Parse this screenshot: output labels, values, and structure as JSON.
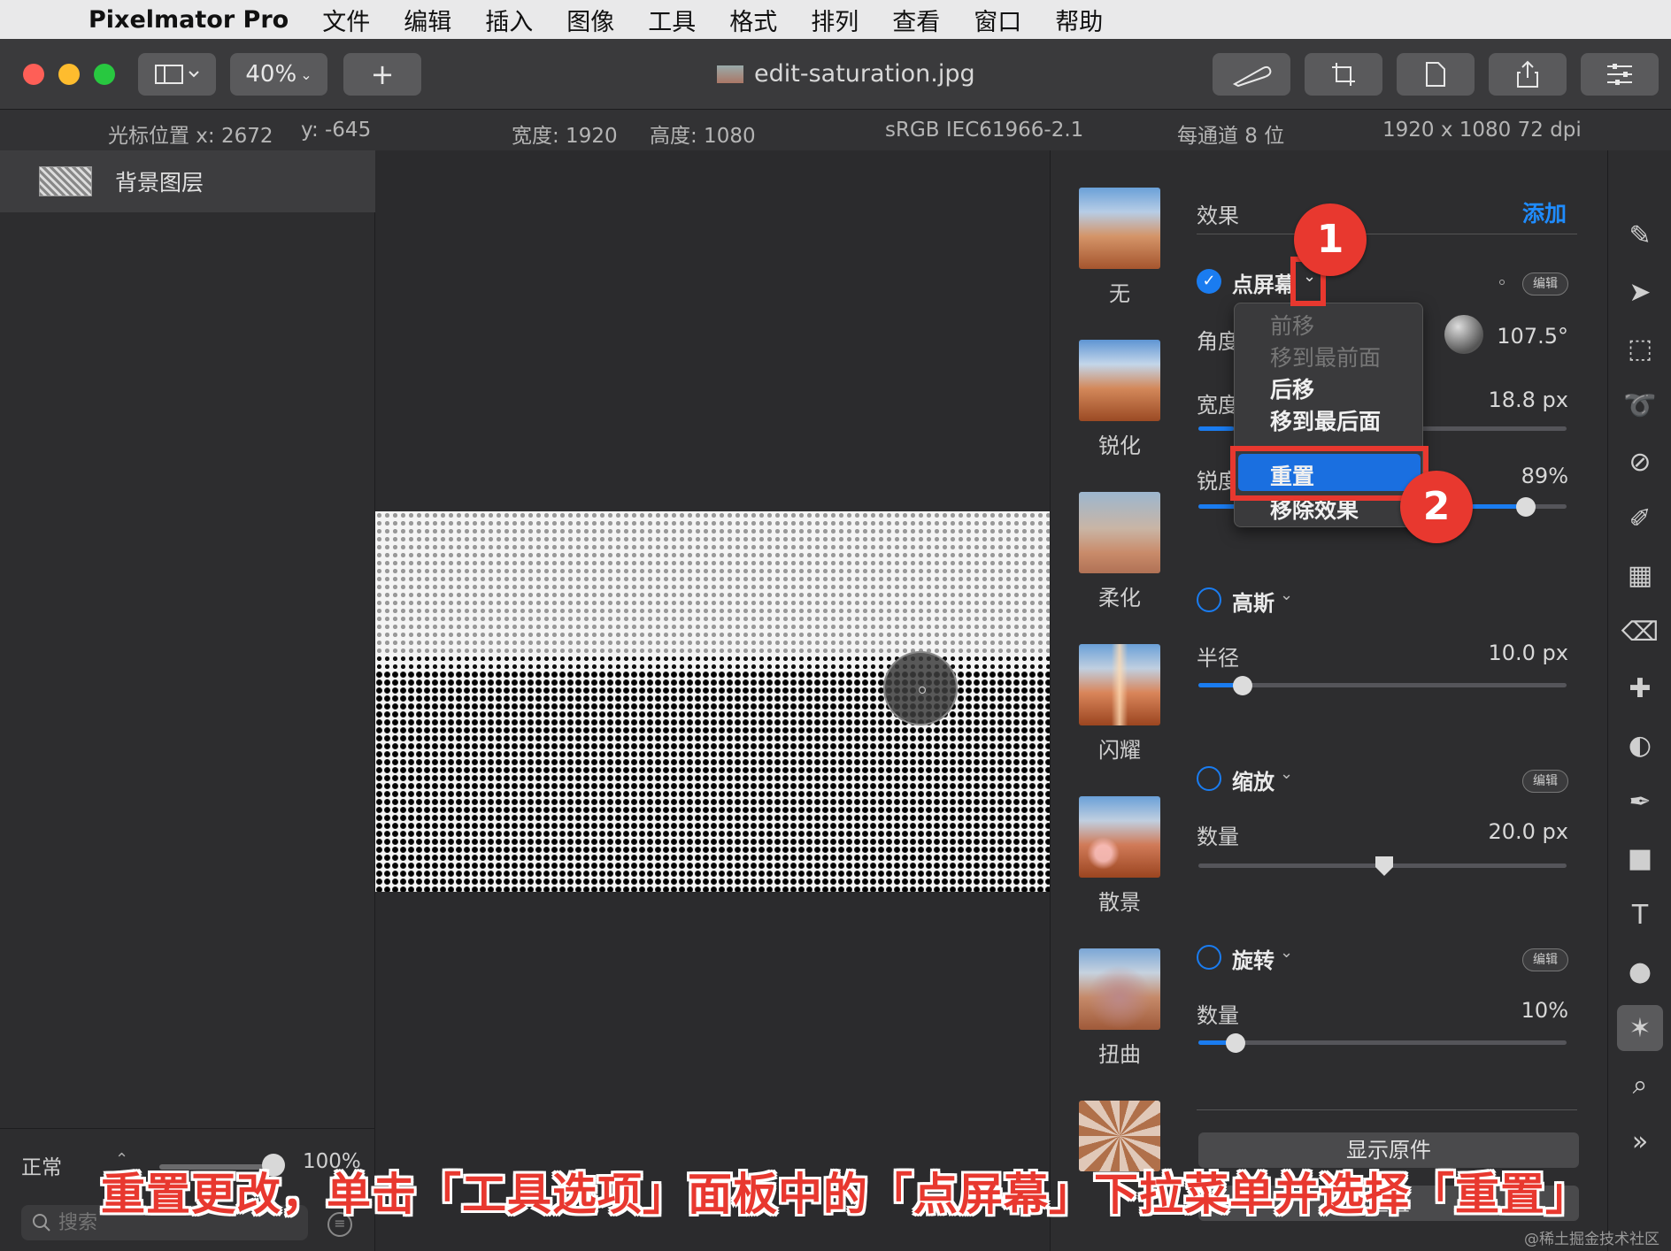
{
  "menubar": {
    "apple": "",
    "app_name": "Pixelmator Pro",
    "items": [
      "文件",
      "编辑",
      "插入",
      "图像",
      "工具",
      "格式",
      "排列",
      "查看",
      "窗口",
      "帮助"
    ]
  },
  "toolbar": {
    "zoom": "40%",
    "add_label": "+",
    "document_title": "edit-saturation.jpg"
  },
  "infobar": {
    "cursor_x": "光标位置 x: 2672",
    "cursor_y": "y: -645",
    "width": "宽度: 1920",
    "height": "高度: 1080",
    "color_profile": "sRGB IEC61966-2.1",
    "bits": "每通道 8 位",
    "resolution": "1920 x 1080 72 dpi"
  },
  "layers": {
    "items": [
      {
        "name": "背景图层"
      }
    ],
    "blend_mode": "正常",
    "opacity": "100%",
    "search_placeholder": "搜索"
  },
  "presets": [
    {
      "label": "无"
    },
    {
      "label": "锐化"
    },
    {
      "label": "柔化"
    },
    {
      "label": "闪耀"
    },
    {
      "label": "散景"
    },
    {
      "label": "扭曲"
    }
  ],
  "effects": {
    "header": "效果",
    "add_label": "添加",
    "edit_label": "编辑",
    "halftone": {
      "name": "点屏幕",
      "angle_label": "角度",
      "angle_value": "107.5°",
      "width_label": "宽度",
      "width_value": "18.8 px",
      "sharpness_label": "锐度",
      "sharpness_value": "89%",
      "sharpness_fraction": 0.89
    },
    "gaussian": {
      "name": "高斯",
      "radius_label": "半径",
      "radius_value": "10.0 px",
      "radius_fraction": 0.12
    },
    "zoom": {
      "name": "缩放",
      "amount_label": "数量",
      "amount_value": "20.0 px"
    },
    "rotate": {
      "name": "旋转",
      "amount_label": "数量",
      "amount_value": "10%",
      "amount_fraction": 0.1
    },
    "show_original": "显示原件",
    "reset_button": "重置"
  },
  "dropdown": {
    "items": [
      {
        "label": "前移",
        "enabled": false
      },
      {
        "label": "移到最前面",
        "enabled": false
      },
      {
        "label": "后移",
        "enabled": true
      },
      {
        "label": "移到最后面",
        "enabled": true
      },
      {
        "label": "重置",
        "enabled": true,
        "selected": true
      },
      {
        "label": "移除效果",
        "enabled": true
      }
    ]
  },
  "annotations": {
    "badge1": "1",
    "badge2": "2",
    "caption": "重置更改，单击「工具选项」面板中的「点屏幕」下拉菜单并选择「重置」",
    "watermark": "@稀土掘金技术社区"
  },
  "colors": {
    "accent": "#1a7cf0",
    "annotation_red": "#e8382f"
  }
}
